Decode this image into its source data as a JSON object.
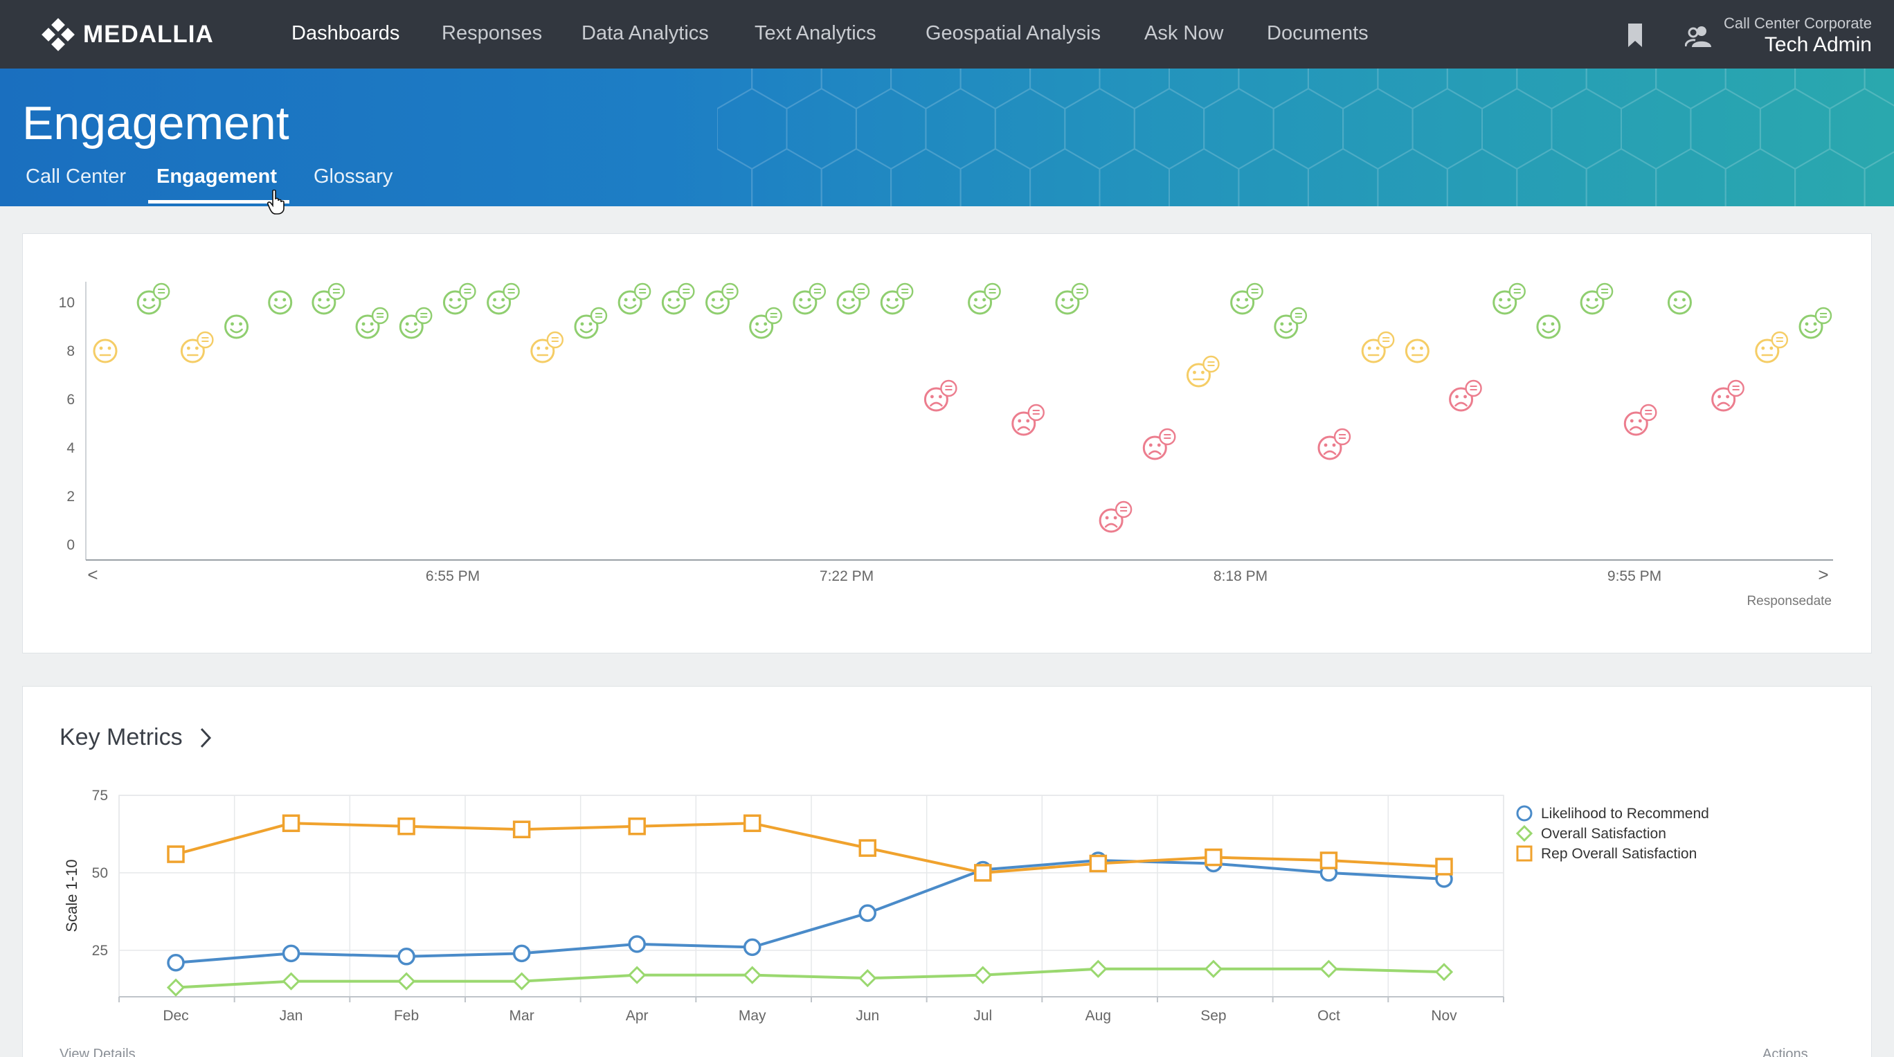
{
  "brand": {
    "name": "MEDALLIA"
  },
  "nav": {
    "items": [
      {
        "label": "Dashboards",
        "active": true
      },
      {
        "label": "Responses",
        "active": false
      },
      {
        "label": "Data Analytics",
        "active": false
      },
      {
        "label": "Text Analytics",
        "active": false
      },
      {
        "label": "Geospatial Analysis",
        "active": false
      },
      {
        "label": "Ask Now",
        "active": false
      },
      {
        "label": "Documents",
        "active": false
      }
    ],
    "org": "Call Center Corporate",
    "user": "Tech Admin"
  },
  "header": {
    "title": "Engagement",
    "tabs": [
      {
        "label": "Call Center",
        "active": false
      },
      {
        "label": "Engagement",
        "active": true
      },
      {
        "label": "Glossary",
        "active": false
      }
    ]
  },
  "colors": {
    "positive": "#8fce6f",
    "neutral": "#f5cd66",
    "negative": "#ec7d8e",
    "series_ltr": "#4a8bc9",
    "series_osat": "#9ad86f",
    "series_rep": "#f0a22d"
  },
  "chart_data": [
    {
      "type": "scatter",
      "xlabel": "Responsedate",
      "ylim": [
        0,
        10
      ],
      "yticks": [
        0,
        2,
        4,
        6,
        8,
        10
      ],
      "xticks": [
        "6:55 PM",
        "7:22 PM",
        "8:18 PM",
        "9:55 PM"
      ],
      "nav_prev": "<",
      "nav_next": ">",
      "points": [
        {
          "y": 8,
          "mood": "neutral",
          "comment": false
        },
        {
          "y": 10,
          "mood": "positive",
          "comment": true
        },
        {
          "y": 8,
          "mood": "neutral",
          "comment": true
        },
        {
          "y": 9,
          "mood": "positive",
          "comment": false
        },
        {
          "y": 10,
          "mood": "positive",
          "comment": false
        },
        {
          "y": 10,
          "mood": "positive",
          "comment": true
        },
        {
          "y": 9,
          "mood": "positive",
          "comment": true
        },
        {
          "y": 9,
          "mood": "positive",
          "comment": true
        },
        {
          "y": 10,
          "mood": "positive",
          "comment": true
        },
        {
          "y": 10,
          "mood": "positive",
          "comment": true
        },
        {
          "y": 8,
          "mood": "neutral",
          "comment": true
        },
        {
          "y": 9,
          "mood": "positive",
          "comment": true
        },
        {
          "y": 10,
          "mood": "positive",
          "comment": true
        },
        {
          "y": 10,
          "mood": "positive",
          "comment": true
        },
        {
          "y": 10,
          "mood": "positive",
          "comment": true
        },
        {
          "y": 9,
          "mood": "positive",
          "comment": true
        },
        {
          "y": 10,
          "mood": "positive",
          "comment": true
        },
        {
          "y": 10,
          "mood": "positive",
          "comment": true
        },
        {
          "y": 10,
          "mood": "positive",
          "comment": true
        },
        {
          "y": 6,
          "mood": "negative",
          "comment": true
        },
        {
          "y": 10,
          "mood": "positive",
          "comment": true
        },
        {
          "y": 5,
          "mood": "negative",
          "comment": true
        },
        {
          "y": 10,
          "mood": "positive",
          "comment": true
        },
        {
          "y": 1,
          "mood": "negative",
          "comment": true
        },
        {
          "y": 4,
          "mood": "negative",
          "comment": true
        },
        {
          "y": 7,
          "mood": "neutral",
          "comment": true
        },
        {
          "y": 10,
          "mood": "positive",
          "comment": true
        },
        {
          "y": 9,
          "mood": "positive",
          "comment": true
        },
        {
          "y": 4,
          "mood": "negative",
          "comment": true
        },
        {
          "y": 8,
          "mood": "neutral",
          "comment": true
        },
        {
          "y": 8,
          "mood": "neutral",
          "comment": false
        },
        {
          "y": 6,
          "mood": "negative",
          "comment": true
        },
        {
          "y": 10,
          "mood": "positive",
          "comment": true
        },
        {
          "y": 9,
          "mood": "positive",
          "comment": false
        },
        {
          "y": 10,
          "mood": "positive",
          "comment": true
        },
        {
          "y": 5,
          "mood": "negative",
          "comment": true
        },
        {
          "y": 10,
          "mood": "positive",
          "comment": false
        },
        {
          "y": 6,
          "mood": "negative",
          "comment": true
        },
        {
          "y": 8,
          "mood": "neutral",
          "comment": true
        },
        {
          "y": 9,
          "mood": "positive",
          "comment": true
        }
      ]
    },
    {
      "type": "line",
      "title": "Key Metrics",
      "ylabel": "Scale 1-10",
      "ylim": [
        10,
        75
      ],
      "yticks": [
        25,
        50,
        75
      ],
      "grid": true,
      "legend": "right",
      "categories": [
        "Dec",
        "Jan",
        "Feb",
        "Mar",
        "Apr",
        "May",
        "Jun",
        "Jul",
        "Aug",
        "Sep",
        "Oct",
        "Nov"
      ],
      "series": [
        {
          "name": "Likelihood to Recommend",
          "marker": "circle",
          "values": [
            21,
            24,
            23,
            24,
            27,
            26,
            37,
            51,
            54,
            53,
            50,
            48
          ]
        },
        {
          "name": "Overall Satisfaction",
          "marker": "diamond",
          "values": [
            13,
            15,
            15,
            15,
            17,
            17,
            16,
            17,
            19,
            19,
            19,
            18
          ]
        },
        {
          "name": "Rep Overall Satisfaction",
          "marker": "square",
          "values": [
            56,
            66,
            65,
            64,
            65,
            66,
            58,
            50,
            53,
            55,
            54,
            52
          ]
        }
      ]
    }
  ],
  "footer": {
    "view_details": "View Details",
    "actions": "Actions"
  }
}
